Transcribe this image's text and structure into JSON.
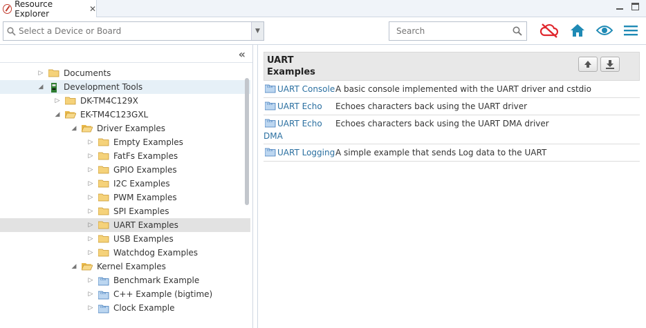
{
  "tab": {
    "label": "Resource Explorer"
  },
  "toolbar": {
    "device_placeholder": "Select a Device or Board",
    "search_placeholder": "Search",
    "colors": {
      "cloud": "#e0262d",
      "home": "#1f8ab5",
      "eye": "#1f8ab5",
      "menu": "#1f8ab5"
    }
  },
  "tree": [
    {
      "label": "Documents",
      "expanded": false,
      "icon": "folder-icon"
    },
    {
      "label": "Development Tools",
      "expanded": true,
      "icon": "board-icon",
      "state": "highlight"
    },
    {
      "label": "DK-TM4C129X",
      "expanded": false,
      "icon": "folder-icon"
    },
    {
      "label": "EK-TM4C123GXL",
      "expanded": true,
      "icon": "folder-open-icon"
    },
    {
      "label": "Driver Examples",
      "expanded": true,
      "icon": "folder-open-icon"
    },
    {
      "label": "Empty Examples",
      "expanded": false,
      "icon": "folder-icon"
    },
    {
      "label": "FatFs Examples",
      "expanded": false,
      "icon": "folder-icon"
    },
    {
      "label": "GPIO Examples",
      "expanded": false,
      "icon": "folder-icon"
    },
    {
      "label": "I2C Examples",
      "expanded": false,
      "icon": "folder-icon"
    },
    {
      "label": "PWM Examples",
      "expanded": false,
      "icon": "folder-icon"
    },
    {
      "label": "SPI Examples",
      "expanded": false,
      "icon": "folder-icon"
    },
    {
      "label": "UART Examples",
      "expanded": false,
      "icon": "folder-icon",
      "state": "selected"
    },
    {
      "label": "USB Examples",
      "expanded": false,
      "icon": "folder-icon"
    },
    {
      "label": "Watchdog Examples",
      "expanded": false,
      "icon": "folder-icon"
    },
    {
      "label": "Kernel Examples",
      "expanded": true,
      "icon": "folder-open-icon"
    },
    {
      "label": "Benchmark Example",
      "expanded": false,
      "icon": "ccs-project-icon"
    },
    {
      "label": "C++ Example (bigtime)",
      "expanded": false,
      "icon": "ccs-project-icon"
    },
    {
      "label": "Clock Example",
      "expanded": false,
      "icon": "ccs-project-icon"
    }
  ],
  "content": {
    "title_line1": "UART",
    "title_line2": "Examples",
    "examples": [
      {
        "name": "UART Console",
        "name2": "",
        "desc": "A basic console implemented with the UART driver and cstdio"
      },
      {
        "name": "UART Echo",
        "name2": "",
        "desc": "Echoes characters back using the UART driver"
      },
      {
        "name": "UART Echo",
        "name2": "DMA",
        "desc": "Echoes characters back using the UART DMA driver"
      },
      {
        "name": "UART Logging",
        "name2": "",
        "desc": "A simple example that sends Log data to the UART"
      }
    ]
  }
}
